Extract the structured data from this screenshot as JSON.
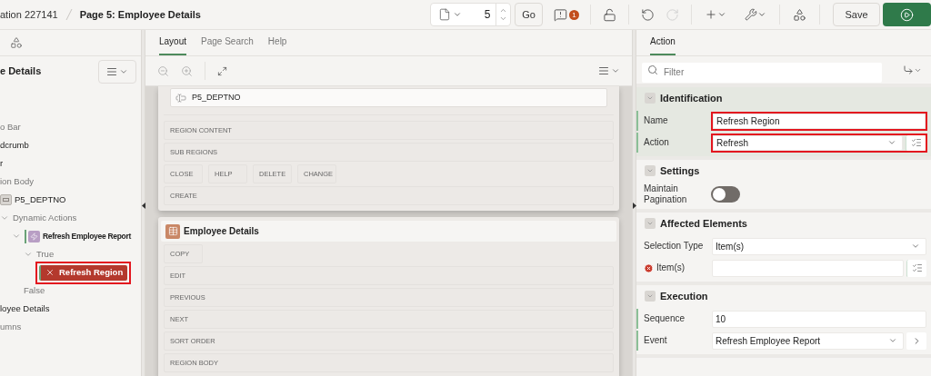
{
  "header": {
    "breadcrumb": [
      {
        "label": "ation 227141"
      },
      {
        "label": "Page 5: Employee Details"
      }
    ]
  },
  "toolbar": {
    "page_number": "5",
    "go": "Go",
    "warning_count": "1",
    "undo": {
      "disabled": false
    },
    "redo": {
      "disabled": true
    },
    "save": "Save"
  },
  "left_panel": {
    "title": "e Details",
    "tree": [
      {
        "label": "o Bar",
        "kind": "group",
        "selected": false
      },
      {
        "label": "dcrumb",
        "kind": "component",
        "selected": false
      },
      {
        "label": "r",
        "kind": "component",
        "selected": false
      },
      {
        "label": "ion Body",
        "kind": "group",
        "selected": false,
        "children": [
          {
            "label": "P5_DEPTNO",
            "kind": "page-item",
            "selected": false,
            "children": [
              {
                "label": "Dynamic Actions",
                "kind": "group",
                "selected": false,
                "expanded": true,
                "children": [
                  {
                    "label": "Refresh Employee Report",
                    "kind": "dynamic-action",
                    "selected": false,
                    "expanded": true,
                    "children": [
                      {
                        "label": "True",
                        "kind": "branch",
                        "selected": false,
                        "expanded": true,
                        "children": [
                          {
                            "label": "Refresh Region",
                            "kind": "action",
                            "selected": true,
                            "highlighted": true
                          }
                        ]
                      },
                      {
                        "label": "False",
                        "kind": "branch",
                        "selected": false
                      }
                    ]
                  }
                ]
              }
            ]
          }
        ]
      },
      {
        "label": "loyee Details",
        "kind": "component",
        "selected": false
      },
      {
        "label": "umns",
        "kind": "group",
        "selected": false
      }
    ]
  },
  "center": {
    "tabs": [
      {
        "label": "Layout",
        "selected": true
      },
      {
        "label": "Page Search",
        "selected": false
      },
      {
        "label": "Help",
        "selected": false
      }
    ],
    "canvas": {
      "regions": [
        {
          "item": "P5_DEPTNO",
          "slots": [
            {
              "kind": "wide",
              "labels": [
                "REGION CONTENT"
              ]
            },
            {
              "kind": "wide",
              "labels": [
                "SUB REGIONS"
              ]
            },
            {
              "kind": "buttons",
              "labels": [
                "CLOSE",
                "HELP",
                "DELETE",
                "CHANGE"
              ]
            },
            {
              "kind": "wide",
              "labels": [
                "CREATE"
              ]
            }
          ]
        },
        {
          "title": "Employee Details",
          "slots": [
            {
              "kind": "buttons",
              "labels": [
                "COPY"
              ]
            },
            {
              "kind": "wide",
              "labels": [
                "EDIT"
              ]
            },
            {
              "kind": "wide",
              "labels": [
                "PREVIOUS"
              ]
            },
            {
              "kind": "wide",
              "labels": [
                "NEXT"
              ]
            },
            {
              "kind": "wide",
              "labels": [
                "SORT ORDER"
              ]
            },
            {
              "kind": "wide",
              "labels": [
                "REGION BODY"
              ]
            }
          ]
        }
      ]
    }
  },
  "right_panel": {
    "tabs": [
      {
        "label": "Action",
        "selected": true
      }
    ],
    "filter": {
      "placeholder": "Filter"
    },
    "sections": [
      {
        "title": "Identification",
        "current": true,
        "properties": [
          {
            "label": "Name",
            "kind": "text",
            "value": "Refresh Region",
            "required": true,
            "highlighted": true
          },
          {
            "label": "Action",
            "kind": "select",
            "value": "Refresh",
            "required": true,
            "highlighted": true,
            "list_button": true
          }
        ]
      },
      {
        "title": "Settings",
        "current": false,
        "properties": [
          {
            "label": "Maintain Pagination",
            "kind": "switch",
            "on": false
          }
        ]
      },
      {
        "title": "Affected Elements",
        "current": false,
        "properties": [
          {
            "label": "Selection Type",
            "kind": "select",
            "value": "Item(s)"
          },
          {
            "label": "Item(s)",
            "kind": "text",
            "error": true,
            "list_button": true
          }
        ]
      },
      {
        "title": "Execution",
        "current": false,
        "properties": [
          {
            "label": "Sequence",
            "kind": "text",
            "value": "10",
            "required": true
          },
          {
            "label": "Event",
            "kind": "select",
            "value": "Refresh Employee Report",
            "required": true,
            "go_button": true
          }
        ]
      }
    ]
  }
}
